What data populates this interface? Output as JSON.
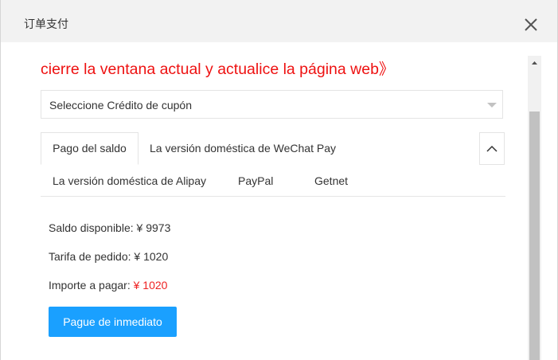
{
  "dialog": {
    "title": "订单支付",
    "close_icon": "close-icon"
  },
  "notice": "cierre la ventana actual y actualice la página web》",
  "coupon": {
    "selected": "Seleccione Crédito de cupón"
  },
  "payment_tabs": [
    {
      "label": "Pago del saldo",
      "active": true
    },
    {
      "label": "La versión doméstica de WeChat Pay",
      "active": false
    },
    {
      "label": "La versión doméstica de Alipay",
      "active": false
    },
    {
      "label": "PayPal",
      "active": false
    },
    {
      "label": "Getnet",
      "active": false
    }
  ],
  "balance": {
    "available_label": "Saldo disponible: ",
    "available_value": "¥ 9973",
    "fee_label": "Tarifa de pedido: ",
    "fee_value": "¥ 1020",
    "due_label": "Importe a pagar: ",
    "due_value": "¥ 1020"
  },
  "pay_button": "Pague de inmediato",
  "colors": {
    "notice": "#ee1111",
    "button": "#1aa0ff",
    "due_amount": "#ee2222",
    "titlebar": "#f2f2f2"
  }
}
